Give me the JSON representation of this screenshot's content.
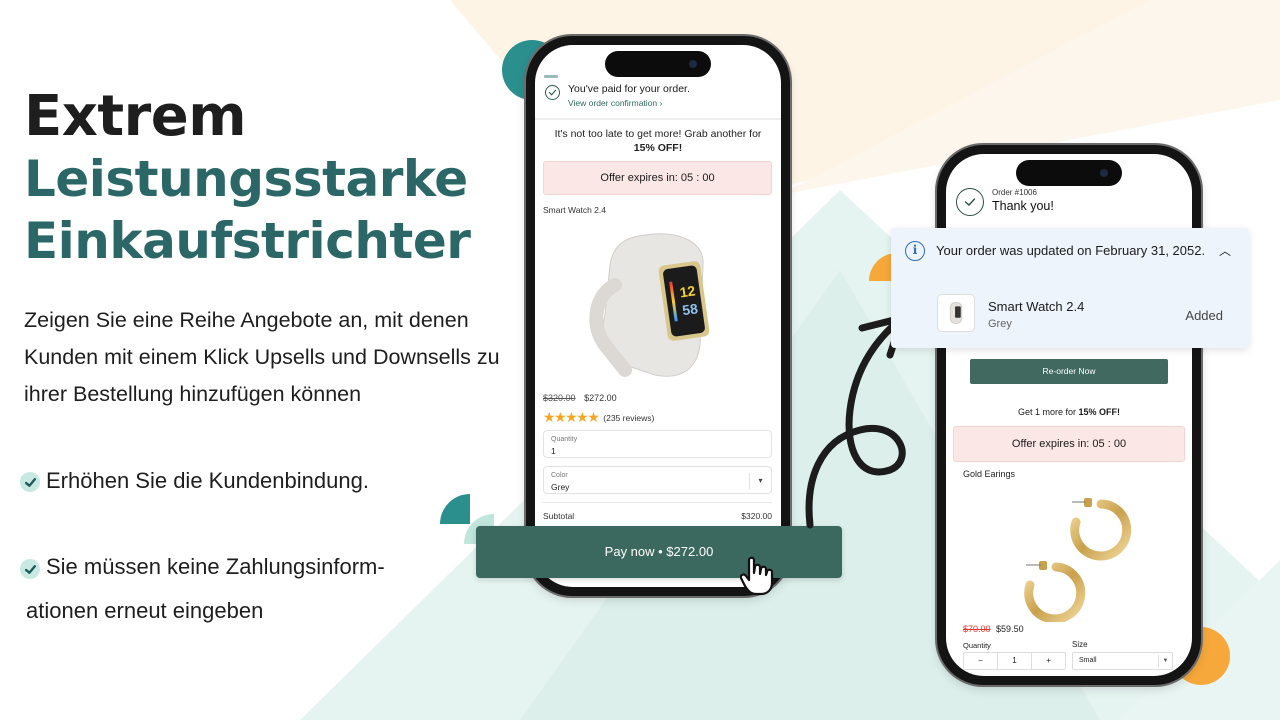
{
  "hero": {
    "headline_line1": "Extrem",
    "headline_line2": "Leistungsstarke",
    "headline_line3": "Einkaufstrichter",
    "description": "Zeigen Sie eine Reihe Angebote an, mit denen Kunden mit einem Klick Upsells und Downsells zu ihrer Bestellung hinzufügen können",
    "benefits": [
      {
        "icon": "check-icon",
        "text": "Erhöhen Sie die Kundenbindung."
      },
      {
        "icon": "check-icon",
        "text_line1": "Sie müssen keine Zahlungsinform-",
        "text_line2": "ationen erneut eingeben"
      }
    ]
  },
  "colors": {
    "brand_teal": "#2a6766",
    "button_green": "#3c695f",
    "offer_pink": "#fbe8e6",
    "star_orange": "#f6a623",
    "info_blue": "#2b6cc4",
    "sale_red": "#e4352d"
  },
  "phone_checkout": {
    "paid_title": "You've paid for your order.",
    "paid_link": "View order confirmation ›",
    "upsell_text": "It's not too late to get more! Grab another for",
    "upsell_discount": "15% OFF!",
    "offer_timer": "Offer expires in: 05 : 00",
    "product_name": "Smart Watch 2.4",
    "price_old": "$320.00",
    "price_new": "$272.00",
    "rating_stars": 5,
    "reviews": "(235 reviews)",
    "quantity_label": "Quantity",
    "quantity_value": "1",
    "color_label": "Color",
    "color_value": "Grey",
    "subtotal_label": "Subtotal",
    "subtotal_value": "$320.00",
    "pay_button": "Pay now • $272.00"
  },
  "phone_thankyou": {
    "order_number": "Order #1006",
    "thank_you": "Thank you!",
    "reorder_button": "Re-order Now",
    "getmore_prefix": "Get 1 more for ",
    "getmore_discount": "15% OFF!",
    "offer_timer": "Offer expires in: 05 : 00",
    "product_name": "Gold Earings",
    "price_old": "$70.00",
    "price_new": "$59.50",
    "quantity_label": "Quantity",
    "quantity_minus": "−",
    "quantity_value": "1",
    "quantity_plus": "+",
    "size_label": "Size",
    "size_value": "Small"
  },
  "notification": {
    "message": "Your order was updated on February 31, 2052.",
    "item_name": "Smart Watch 2.4",
    "item_variant": "Grey",
    "item_status": "Added"
  }
}
